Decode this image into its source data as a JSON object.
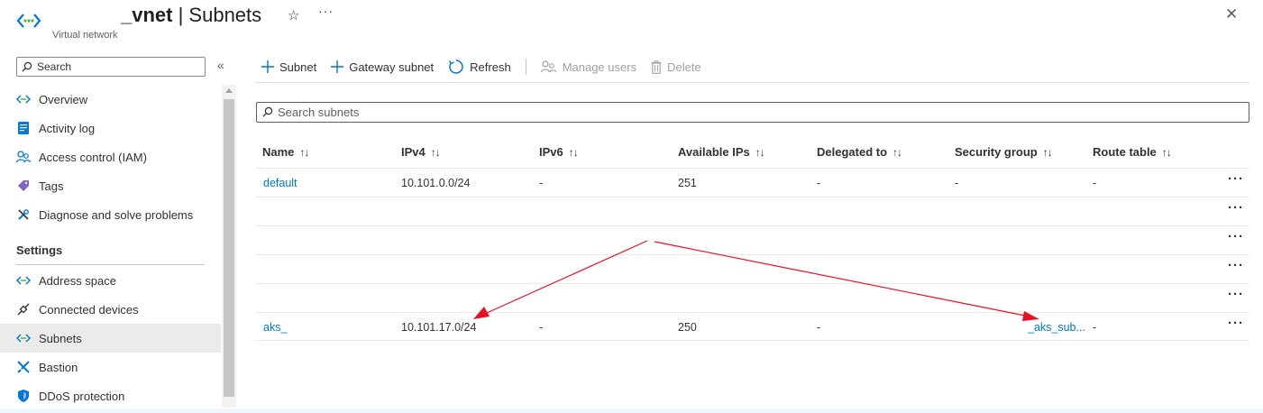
{
  "header": {
    "title_bold": "_vnet",
    "title_rest": " | Subnets",
    "subtitle": "Virtual network",
    "star_glyph": "☆",
    "more_glyph": "···",
    "close_glyph": "✕"
  },
  "sidebar": {
    "search_placeholder": "Search",
    "collapse_glyph": "«",
    "items": [
      {
        "label": "Overview",
        "icon": "vnet-icon"
      },
      {
        "label": "Activity log",
        "icon": "activity-log-icon"
      },
      {
        "label": "Access control (IAM)",
        "icon": "people-icon"
      },
      {
        "label": "Tags",
        "icon": "tag-icon"
      },
      {
        "label": "Diagnose and solve problems",
        "icon": "wrench-icon"
      }
    ],
    "section_label": "Settings",
    "settings_items": [
      {
        "label": "Address space",
        "icon": "vnet-icon"
      },
      {
        "label": "Connected devices",
        "icon": "plug-icon"
      },
      {
        "label": "Subnets",
        "icon": "vnet-icon",
        "active": true
      },
      {
        "label": "Bastion",
        "icon": "bastion-icon"
      },
      {
        "label": "DDoS protection",
        "icon": "shield-icon"
      }
    ]
  },
  "toolbar": {
    "add_subnet": "Subnet",
    "add_gateway_subnet": "Gateway subnet",
    "refresh": "Refresh",
    "manage_users": "Manage users",
    "delete": "Delete"
  },
  "grid": {
    "search_placeholder": "Search subnets",
    "sort_glyph": "↑↓",
    "columns": [
      "Name",
      "IPv4",
      "IPv6",
      "Available IPs",
      "Delegated to",
      "Security group",
      "Route table"
    ],
    "rows": [
      {
        "name": "default",
        "ipv4": "10.101.0.0/24",
        "ipv6": "-",
        "available": "251",
        "delegated": "-",
        "nsg": "-",
        "route": "-"
      },
      {
        "name": "",
        "ipv4": "",
        "ipv6": "",
        "available": "",
        "delegated": "",
        "nsg": "",
        "route": ""
      },
      {
        "name": "",
        "ipv4": "",
        "ipv6": "",
        "available": "",
        "delegated": "",
        "nsg": "",
        "route": ""
      },
      {
        "name": "",
        "ipv4": "",
        "ipv6": "",
        "available": "",
        "delegated": "",
        "nsg": "",
        "route": ""
      },
      {
        "name": "",
        "ipv4": "",
        "ipv6": "",
        "available": "",
        "delegated": "",
        "nsg": "",
        "route": ""
      },
      {
        "name": "aks_",
        "ipv4": "10.101.17.0/24",
        "ipv6": "-",
        "available": "250",
        "delegated": "-",
        "nsg": "_aks_sub...",
        "route": "-"
      }
    ],
    "row_more_glyph": "···"
  },
  "colors": {
    "accent": "#0078d4",
    "annotation_arrow": "#e81123",
    "active_nav": "#edebe9"
  }
}
